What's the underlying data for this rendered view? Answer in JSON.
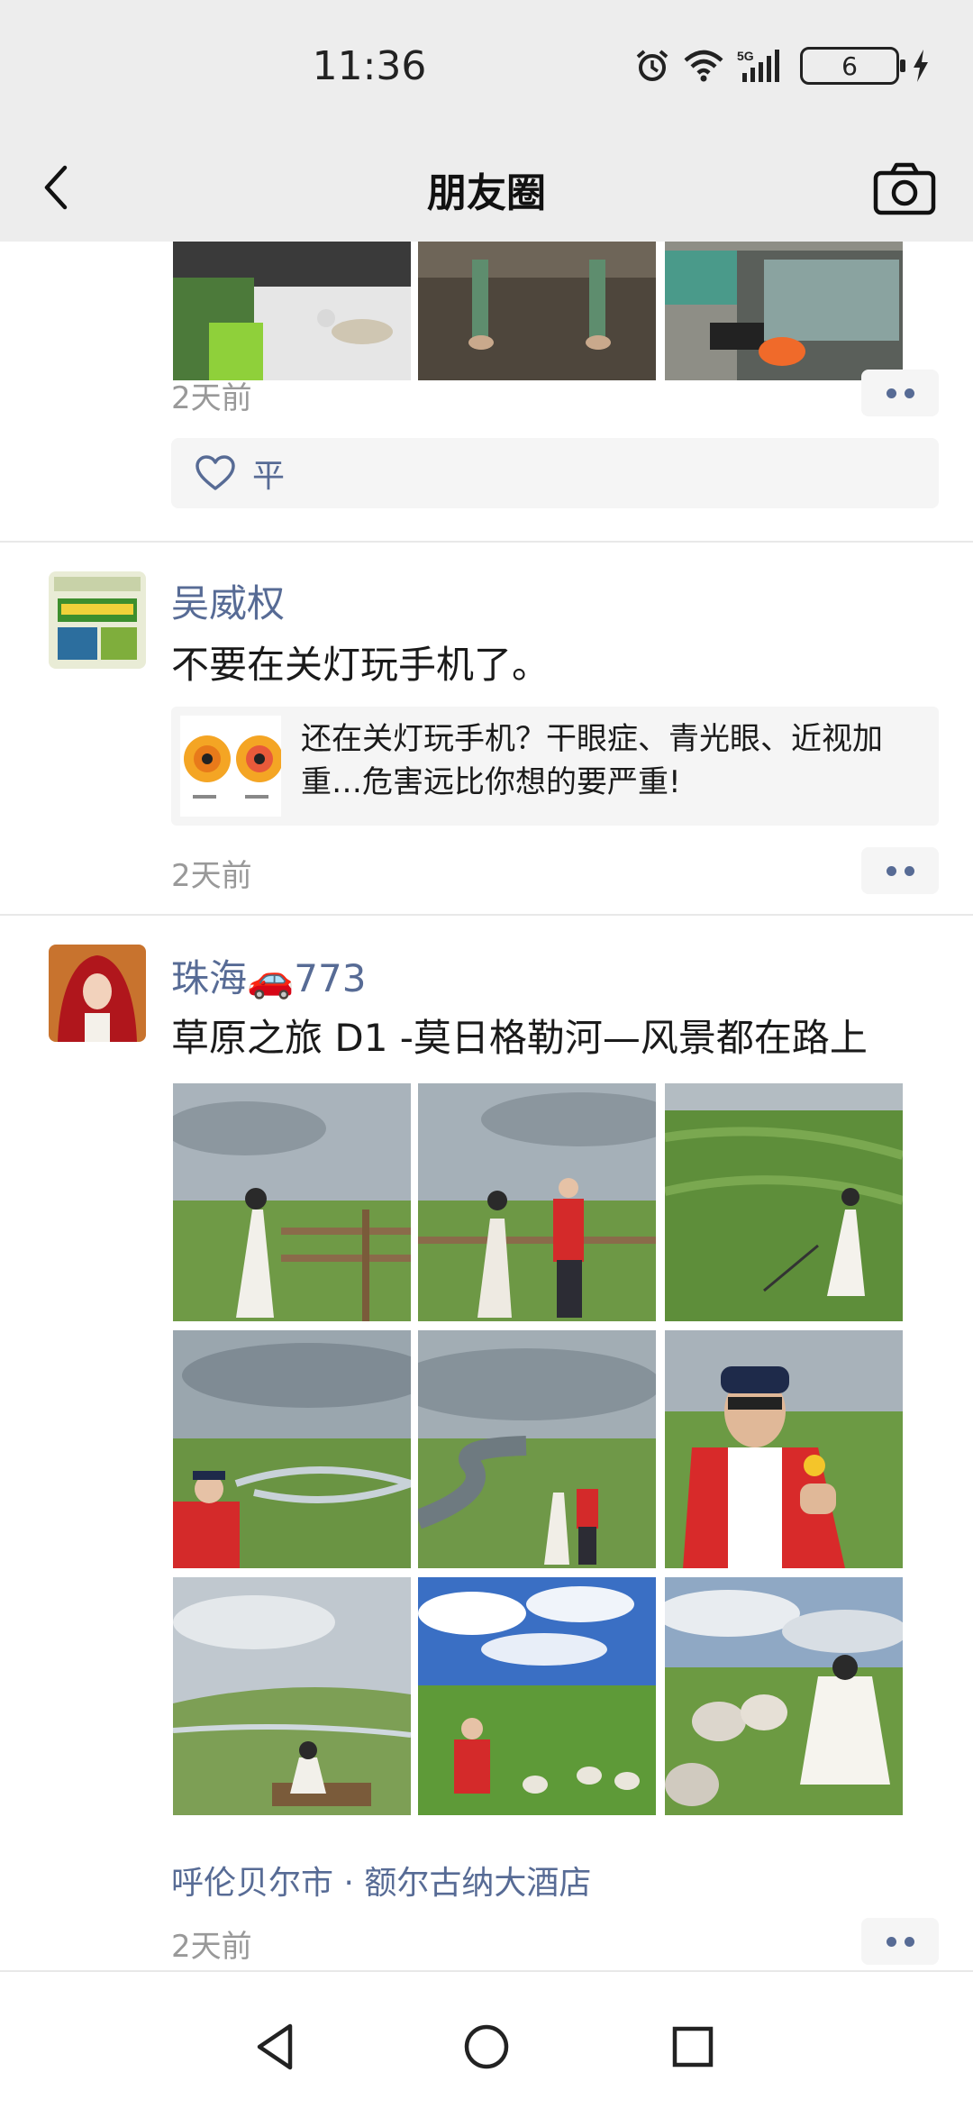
{
  "status_bar": {
    "time": "11:36",
    "network": "5G",
    "battery": "6"
  },
  "header": {
    "title": "朋友圈",
    "back_icon": "chevron-left-icon",
    "camera_icon": "camera-icon"
  },
  "posts": [
    {
      "time": "2天前",
      "likes": "平"
    },
    {
      "author": "吴威权",
      "text": "不要在关灯玩手机了。",
      "link_title": "还在关灯玩手机？干眼症、青光眼、近视加重…危害远比你想的要严重!",
      "time": "2天前"
    },
    {
      "author": "珠海🚗773",
      "text": "草原之旅 D1 -莫日格勒河—风景都在路上",
      "location": "呼伦贝尔市 · 额尔古纳大酒店",
      "time": "2天前"
    }
  ],
  "colors": {
    "link_blue": "#576b95",
    "header_bg": "#ededed",
    "time_gray": "#999999"
  }
}
